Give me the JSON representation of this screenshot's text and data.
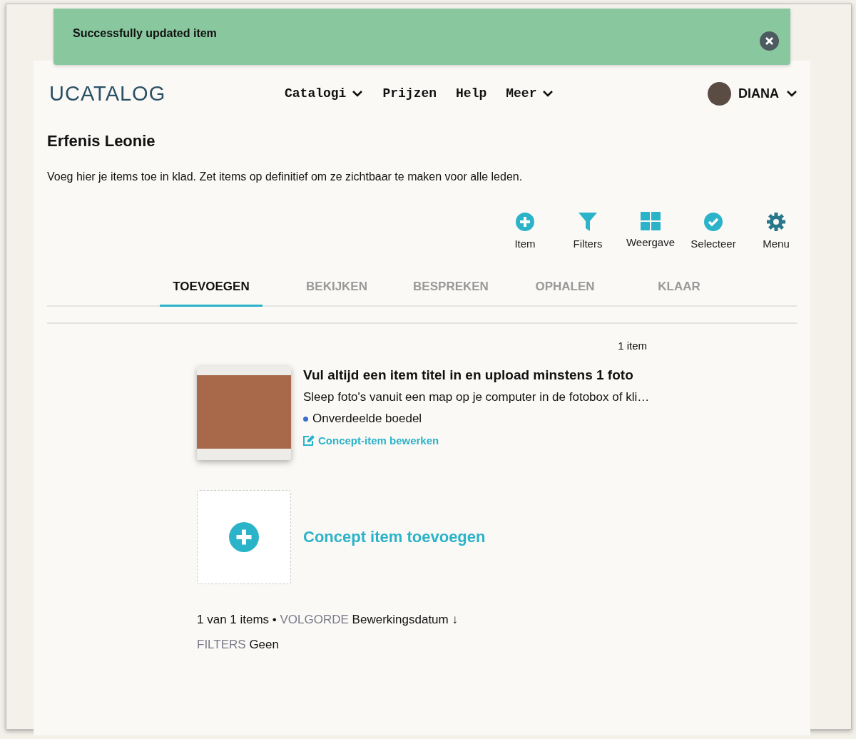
{
  "toast": {
    "message": "Successfully updated item"
  },
  "nav": {
    "logo": "UCATALOG",
    "links": [
      {
        "label": "Catalogi",
        "dropdown": true
      },
      {
        "label": "Prijzen",
        "dropdown": false
      },
      {
        "label": "Help",
        "dropdown": false
      },
      {
        "label": "Meer",
        "dropdown": true
      }
    ],
    "user": "DIANA"
  },
  "page": {
    "title": "Erfenis Leonie",
    "intro": "Voeg hier je items toe in klad. Zet items op definitief om ze zichtbaar te maken voor alle leden."
  },
  "toolbar": [
    {
      "kind": "plus",
      "label": "Item"
    },
    {
      "kind": "filter",
      "label": "Filters"
    },
    {
      "kind": "grid",
      "label": "Weergave"
    },
    {
      "kind": "check",
      "label": "Selecteer"
    },
    {
      "kind": "gear",
      "label": "Menu"
    }
  ],
  "tabs": [
    {
      "label": "TOEVOEGEN",
      "selected": true
    },
    {
      "label": "BEKIJKEN",
      "selected": false
    },
    {
      "label": "BESPREKEN",
      "selected": false
    },
    {
      "label": "OPHALEN",
      "selected": false
    },
    {
      "label": "KLAAR",
      "selected": false
    }
  ],
  "count": "1 item",
  "items": [
    {
      "title": "Vul altijd een item titel in en upload minstens 1 foto",
      "description": "Sleep foto's vanuit een map op je computer in de fotobox of kli…",
      "tag": "Onverdeelde boedel",
      "color": "#3a6fd0",
      "edit": "Concept-item bewerken"
    }
  ],
  "add": "Concept item toevoegen",
  "footer": {
    "summary": "1 van 1 items •",
    "order_label": "VOLGORDE",
    "order_value": "Bewerkingsdatum ↓",
    "filters_label": "FILTERS",
    "filters_value": "Geen"
  }
}
